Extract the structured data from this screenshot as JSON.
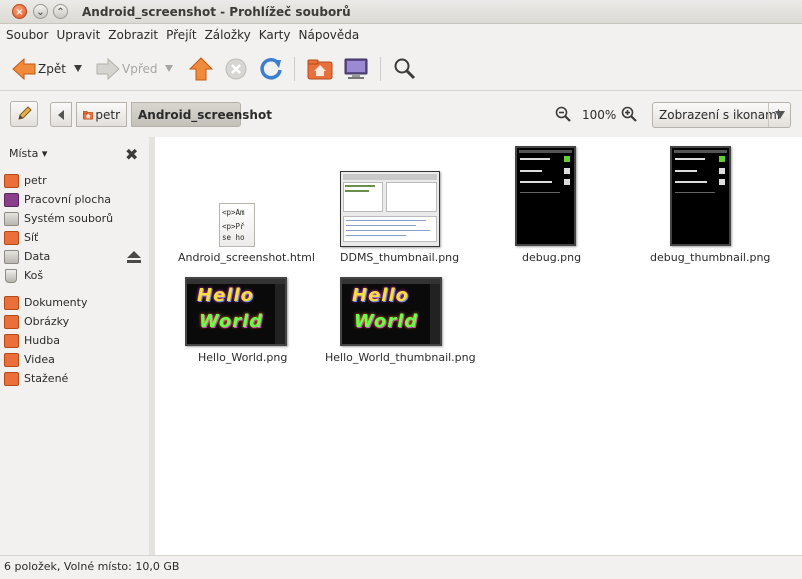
{
  "window": {
    "title": "Android_screenshot - Prohlížeč souborů"
  },
  "menu": [
    {
      "label": "Soubor"
    },
    {
      "label": "Upravit"
    },
    {
      "label": "Zobrazit"
    },
    {
      "label": "Přejít"
    },
    {
      "label": "Záložky"
    },
    {
      "label": "Karty"
    },
    {
      "label": "Nápověda"
    }
  ],
  "toolbar": {
    "back_label": "Zpět",
    "forward_label": "Vpřed"
  },
  "location": {
    "crumbs": [
      "petr",
      "Android_screenshot"
    ],
    "zoom": "100%",
    "view_mode": "Zobrazení s ikonami"
  },
  "sidebar": {
    "header": "Místa",
    "places": [
      {
        "label": "petr",
        "icon": "home-folder-icon"
      },
      {
        "label": "Pracovní plocha",
        "icon": "desktop-icon"
      },
      {
        "label": "Systém souborů",
        "icon": "drive-icon"
      },
      {
        "label": "Síť",
        "icon": "network-icon"
      },
      {
        "label": "Data",
        "icon": "drive-icon"
      },
      {
        "label": "Koš",
        "icon": "trash-icon"
      }
    ],
    "bookmarks": [
      {
        "label": "Dokumenty",
        "icon": "documents-folder-icon"
      },
      {
        "label": "Obrázky",
        "icon": "pictures-folder-icon"
      },
      {
        "label": "Hudba",
        "icon": "music-folder-icon"
      },
      {
        "label": "Videa",
        "icon": "videos-folder-icon"
      },
      {
        "label": "Stažené",
        "icon": "downloads-folder-icon"
      }
    ]
  },
  "files": [
    {
      "name": "Android_screenshot.html",
      "kind": "html",
      "preview": [
        "<p>Am",
        "<p>Př",
        "se ho"
      ]
    },
    {
      "name": "DDMS_thumbnail.png",
      "kind": "ddms"
    },
    {
      "name": "debug.png",
      "kind": "debug"
    },
    {
      "name": "debug_thumbnail.png",
      "kind": "debug"
    },
    {
      "name": "Hello_World.png",
      "kind": "hello",
      "art_text": [
        "Hello",
        "World"
      ]
    },
    {
      "name": "Hello_World_thumbnail.png",
      "kind": "hello",
      "art_text": [
        "Hello",
        "World"
      ]
    }
  ],
  "status": "6 položek, Volné místo: 10,0 GB",
  "colors": {
    "accent_orange": "#e0561e",
    "selection_bg": "#c4c0ba"
  }
}
